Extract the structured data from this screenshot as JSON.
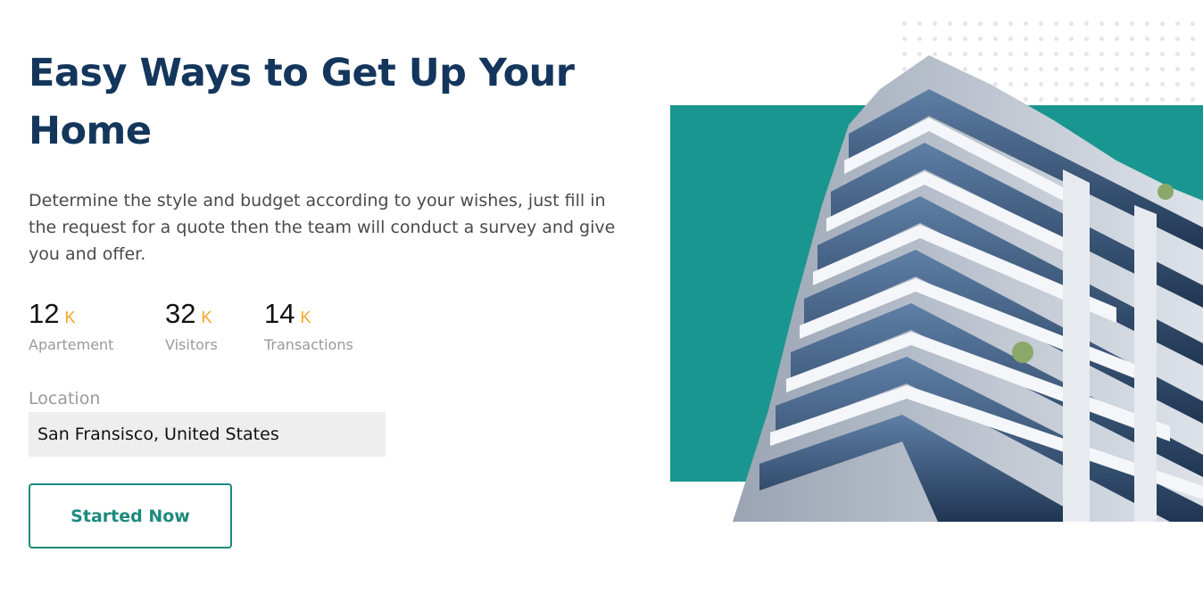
{
  "hero": {
    "title_line1": "Easy Ways to Get Up Your",
    "title_line2": "Home",
    "description": "Determine the style and budget according to your wishes, just fill in the request for a quote then the team will conduct a survey and give you and offer."
  },
  "stats": [
    {
      "value": "12",
      "unit": "K",
      "label": "Apartement"
    },
    {
      "value": "32",
      "unit": "K",
      "label": "Visitors"
    },
    {
      "value": "14",
      "unit": "K",
      "label": "Transactions"
    }
  ],
  "location": {
    "label": "Location",
    "value": "San Fransisco, United States"
  },
  "cta": {
    "label": "Started Now"
  },
  "colors": {
    "title": "#14365c",
    "accent": "#1a9690",
    "button": "#1c8a7e",
    "stat_unit": "#f5a623"
  },
  "icons": {
    "hero_image": "apartment-building-photo"
  }
}
